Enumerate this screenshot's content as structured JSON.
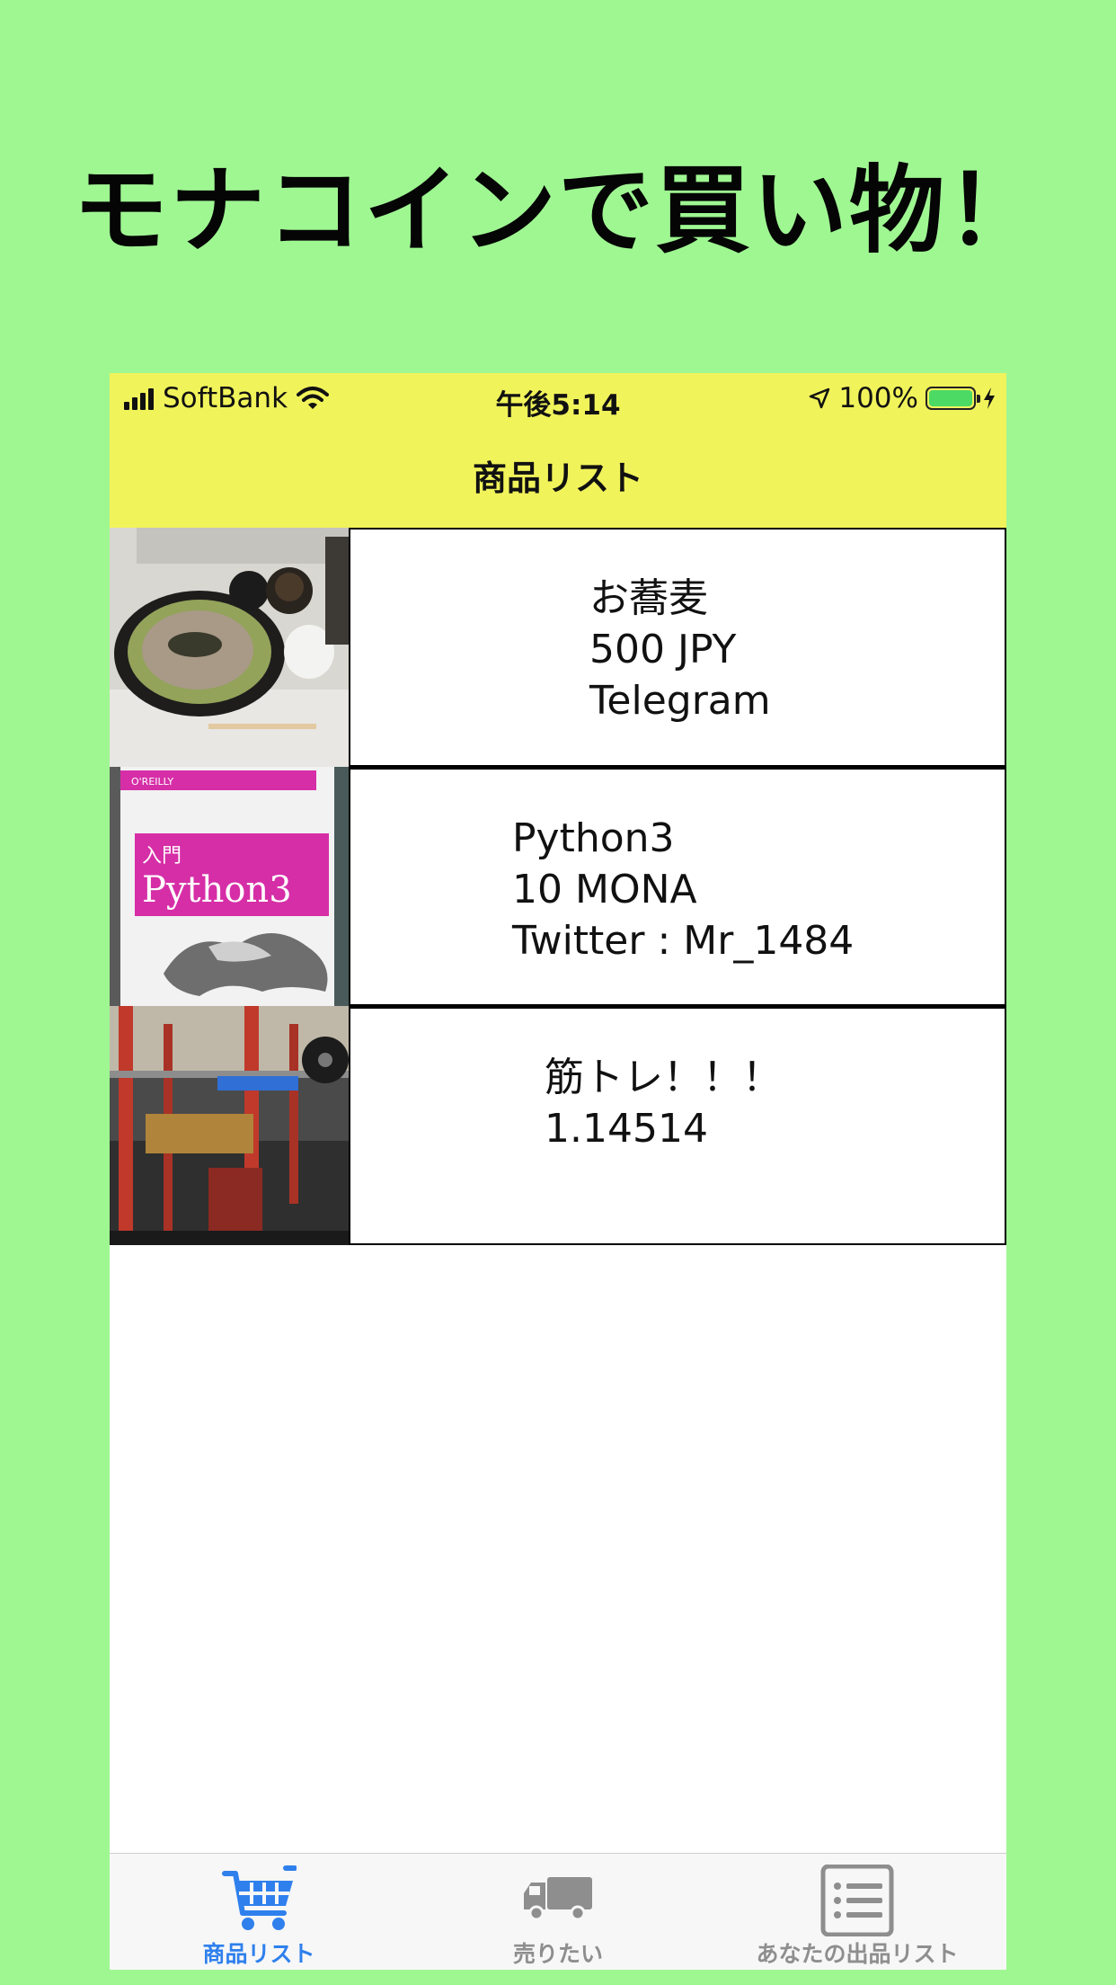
{
  "promo": {
    "title": "モナコインで買い物！"
  },
  "status_bar": {
    "carrier": "SoftBank",
    "time": "午後5:14",
    "battery": "100%",
    "battery_level": 1.0
  },
  "nav": {
    "title": "商品リスト"
  },
  "products": [
    {
      "lines": [
        "お蕎麦",
        "500 JPY",
        "Telegram"
      ],
      "image": "soba-noodles-photo"
    },
    {
      "lines": [
        "Python3",
        "10 MONA",
        "Twitter : Mr_1484"
      ],
      "image": "python3-book-cover-photo"
    },
    {
      "lines": [
        "筋トレ！！！",
        "1.14514"
      ],
      "image": "gym-squat-rack-photo"
    }
  ],
  "tabs": [
    {
      "label": "商品リスト",
      "icon": "cart-icon",
      "active": true
    },
    {
      "label": "売りたい",
      "icon": "truck-icon",
      "active": false
    },
    {
      "label": "あなたの出品リスト",
      "icon": "list-icon",
      "active": false
    }
  ],
  "colors": {
    "background": "#9ff792",
    "navbar": "#f1f35b",
    "tab_active": "#2f80ed",
    "tab_inactive": "#8e8e8e"
  }
}
